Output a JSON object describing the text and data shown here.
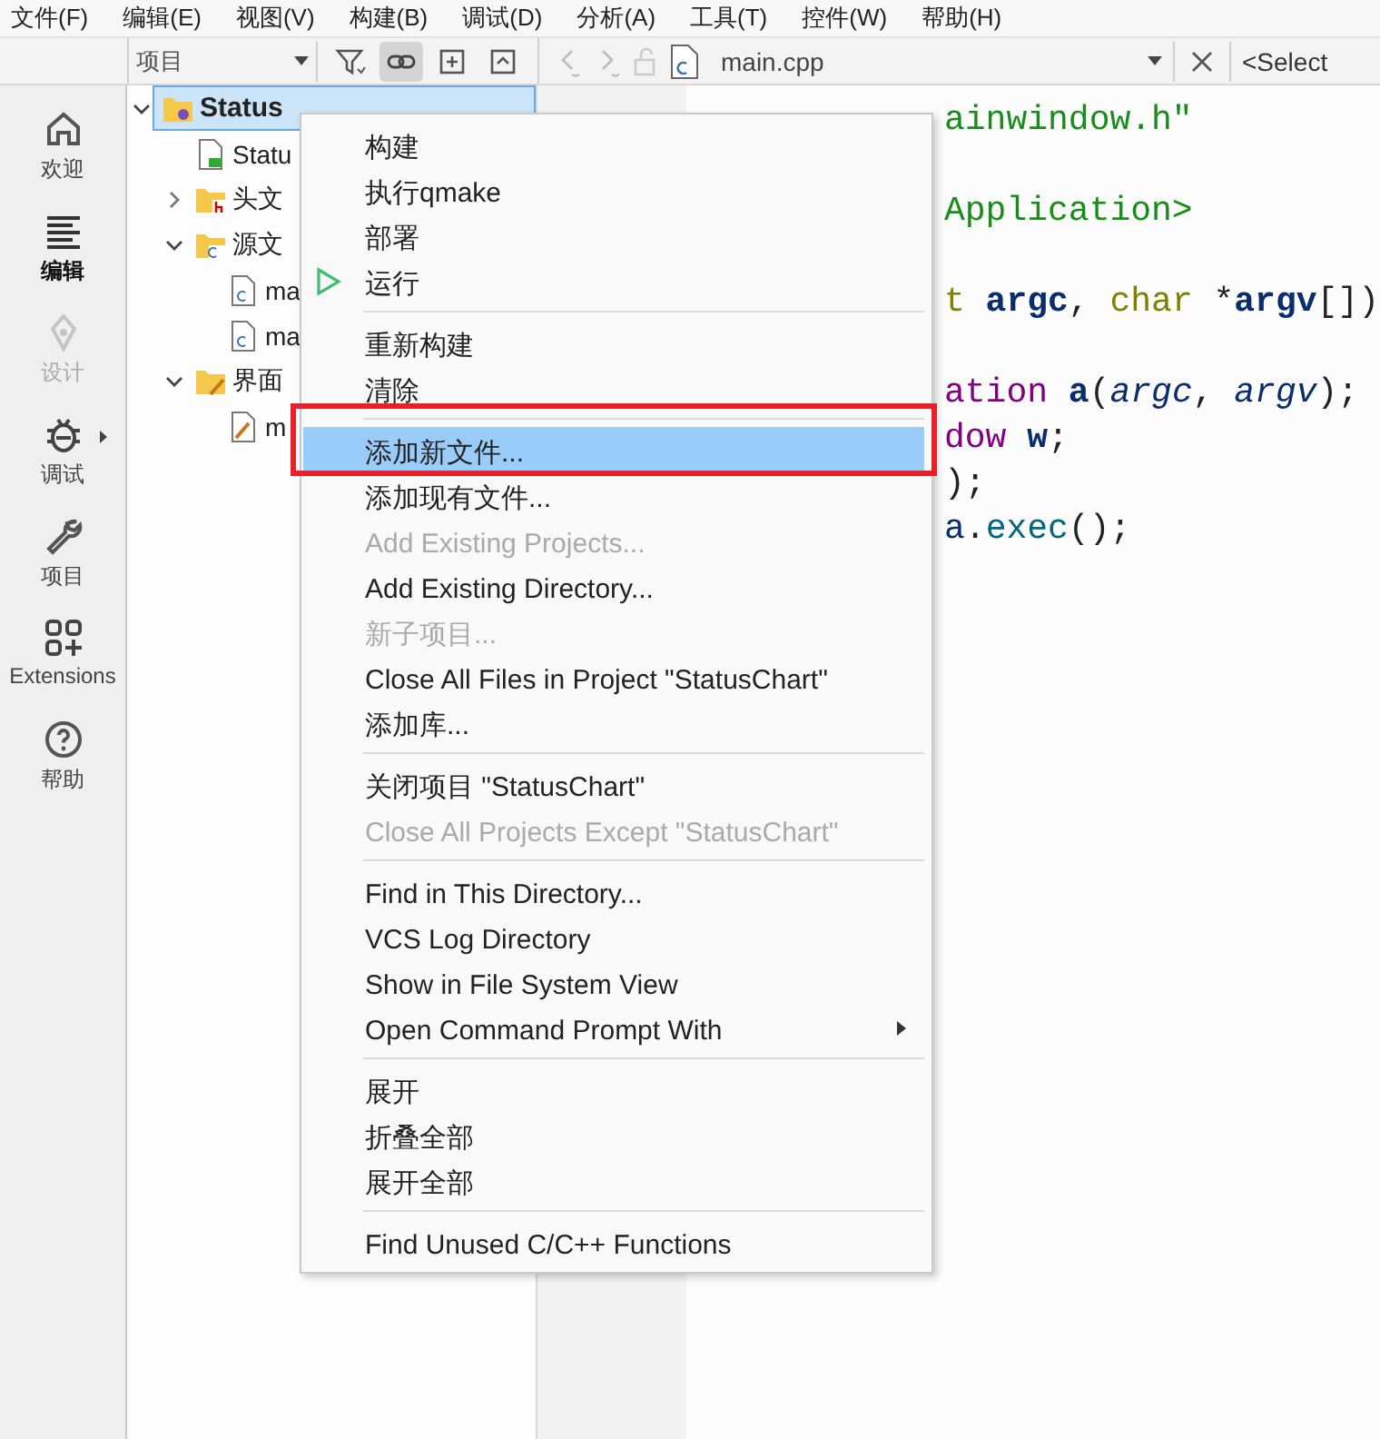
{
  "menubar": [
    "文件(F)",
    "编辑(E)",
    "视图(V)",
    "构建(B)",
    "调试(D)",
    "分析(A)",
    "工具(T)",
    "控件(W)",
    "帮助(H)"
  ],
  "sidebar": {
    "items": [
      {
        "label": "欢迎",
        "selected": false,
        "disabled": false
      },
      {
        "label": "编辑",
        "selected": true,
        "disabled": false
      },
      {
        "label": "设计",
        "selected": false,
        "disabled": true
      },
      {
        "label": "调试",
        "selected": false,
        "disabled": false,
        "submenu": true
      },
      {
        "label": "项目",
        "selected": false,
        "disabled": false
      },
      {
        "label": "Extensions",
        "selected": false,
        "disabled": false
      },
      {
        "label": "帮助",
        "selected": false,
        "disabled": false
      }
    ]
  },
  "project_toolbar": {
    "view_selector": "项目",
    "link_on": true
  },
  "editor_toolbar": {
    "file": "main.cpp",
    "symbol_selector": "<Select"
  },
  "tree": [
    {
      "label": "Status",
      "kind": "project",
      "selected": true,
      "expanded": true,
      "children": [
        {
          "label": "Statu",
          "kind": "pro",
          "selected": false
        },
        {
          "label": "头文",
          "kind": "headers",
          "selected": false,
          "expanded": false
        },
        {
          "label": "源文",
          "kind": "sources",
          "selected": false,
          "expanded": true,
          "children": [
            {
              "label": "ma",
              "kind": "cpp",
              "selected": false
            },
            {
              "label": "ma",
              "kind": "cpp",
              "selected": false
            }
          ]
        },
        {
          "label": "界面",
          "kind": "forms",
          "selected": false,
          "expanded": true,
          "children": [
            {
              "label": "m",
              "kind": "ui",
              "selected": false
            }
          ]
        }
      ]
    }
  ],
  "code_lines": [
    {
      "kind": "code",
      "tokens": [
        {
          "t": "ainwindow.h\"",
          "kind": "string"
        }
      ]
    },
    {
      "kind": "blank"
    },
    {
      "kind": "code",
      "tokens": [
        {
          "t": "Application>",
          "kind": "string"
        }
      ]
    },
    {
      "kind": "blank"
    },
    {
      "kind": "code",
      "tokens": [
        {
          "t": "t",
          "kind": "type"
        },
        {
          "t": " argc",
          "kind": "param"
        },
        {
          "t": ", ",
          "kind": "plain"
        },
        {
          "t": "char",
          "kind": "type"
        },
        {
          "t": " *",
          "kind": "plain"
        },
        {
          "t": "argv",
          "kind": "param"
        },
        {
          "t": "[])",
          "kind": "plain"
        }
      ]
    },
    {
      "kind": "blank"
    },
    {
      "kind": "code",
      "tokens": [
        {
          "t": "ation",
          "kind": "class"
        },
        {
          "t": " a",
          "kind": "local"
        },
        {
          "t": "(",
          "kind": "plain"
        },
        {
          "t": "argc",
          "kind": "arg"
        },
        {
          "t": ", ",
          "kind": "plain"
        },
        {
          "t": "argv",
          "kind": "arg"
        },
        {
          "t": ");",
          "kind": "plain"
        }
      ]
    },
    {
      "kind": "code",
      "tokens": [
        {
          "t": "dow",
          "kind": "class"
        },
        {
          "t": " w",
          "kind": "local"
        },
        {
          "t": ";",
          "kind": "plain"
        }
      ]
    },
    {
      "kind": "code",
      "tokens": [
        {
          "t": ");",
          "kind": "plain"
        }
      ]
    },
    {
      "kind": "code",
      "tokens": [
        {
          "t": "a",
          "kind": "var"
        },
        {
          "t": ".",
          "kind": "plain"
        },
        {
          "t": "exec",
          "kind": "func"
        },
        {
          "t": "();",
          "kind": "plain"
        }
      ]
    }
  ],
  "context_menu": [
    {
      "kind": "item",
      "label": "构建",
      "disabled": false,
      "selected": false
    },
    {
      "kind": "item",
      "label": "执行qmake",
      "disabled": false,
      "selected": false
    },
    {
      "kind": "item",
      "label": "部署",
      "disabled": false,
      "selected": false
    },
    {
      "kind": "run",
      "label": "运行",
      "disabled": false,
      "selected": false
    },
    {
      "kind": "separator"
    },
    {
      "kind": "item",
      "label": "重新构建",
      "disabled": false,
      "selected": false
    },
    {
      "kind": "item",
      "label": "清除",
      "disabled": false,
      "selected": false
    },
    {
      "kind": "separator"
    },
    {
      "kind": "item",
      "label": "添加新文件...",
      "disabled": false,
      "selected": true
    },
    {
      "kind": "item",
      "label": "添加现有文件...",
      "disabled": false,
      "selected": false
    },
    {
      "kind": "item",
      "label": "Add Existing Projects...",
      "disabled": true,
      "selected": false
    },
    {
      "kind": "item",
      "label": "Add Existing Directory...",
      "disabled": false,
      "selected": false
    },
    {
      "kind": "item",
      "label": "新子项目...",
      "disabled": true,
      "selected": false
    },
    {
      "kind": "item",
      "label": "Close All Files in Project \"StatusChart\"",
      "disabled": false,
      "selected": false
    },
    {
      "kind": "item",
      "label": "添加库...",
      "disabled": false,
      "selected": false
    },
    {
      "kind": "separator"
    },
    {
      "kind": "item",
      "label": "关闭项目 \"StatusChart\"",
      "disabled": false,
      "selected": false
    },
    {
      "kind": "item",
      "label": "Close All Projects Except \"StatusChart\"",
      "disabled": true,
      "selected": false
    },
    {
      "kind": "separator"
    },
    {
      "kind": "item",
      "label": "Find in This Directory...",
      "disabled": false,
      "selected": false
    },
    {
      "kind": "item",
      "label": "VCS Log Directory",
      "disabled": false,
      "selected": false
    },
    {
      "kind": "item",
      "label": "Show in File System View",
      "disabled": false,
      "selected": false
    },
    {
      "kind": "submenu",
      "label": "Open Command Prompt With",
      "disabled": false,
      "selected": false
    },
    {
      "kind": "separator"
    },
    {
      "kind": "item",
      "label": "展开",
      "disabled": false,
      "selected": false
    },
    {
      "kind": "item",
      "label": "折叠全部",
      "disabled": false,
      "selected": false
    },
    {
      "kind": "item",
      "label": "展开全部",
      "disabled": false,
      "selected": false
    },
    {
      "kind": "separator"
    },
    {
      "kind": "item",
      "label": "Find Unused C/C++ Functions",
      "disabled": false,
      "selected": false
    }
  ]
}
